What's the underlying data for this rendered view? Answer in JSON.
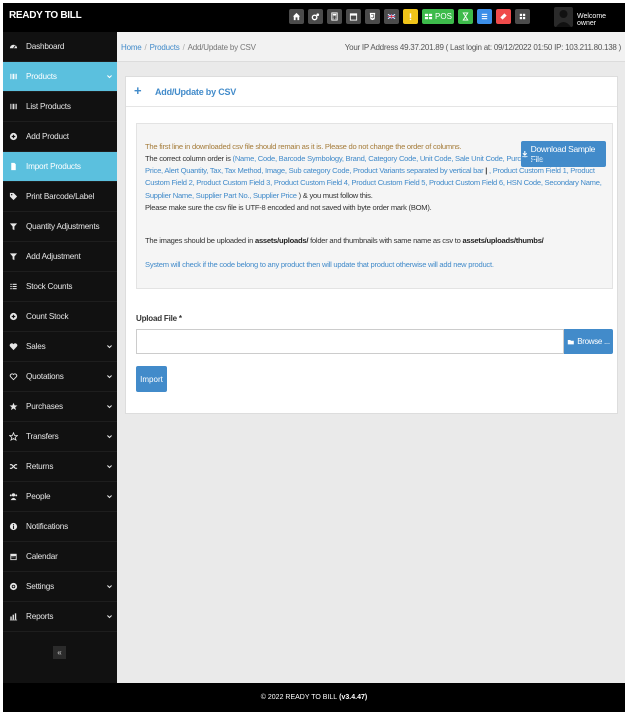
{
  "brand": "READY TO BILL",
  "topbar": {
    "pos_label": "POS",
    "welcome": "Welcome owner"
  },
  "sidebar": {
    "items": [
      {
        "label": "Dashboard",
        "icon": "dashboard-icon"
      },
      {
        "label": "Products",
        "icon": "barcode-icon"
      },
      {
        "label": "List Products",
        "icon": "barcode-icon"
      },
      {
        "label": "Add Product",
        "icon": "plus-circle-icon"
      },
      {
        "label": "Import Products",
        "icon": "file-icon"
      },
      {
        "label": "Print Barcode/Label",
        "icon": "tag-icon"
      },
      {
        "label": "Quantity Adjustments",
        "icon": "filter-icon"
      },
      {
        "label": "Add Adjustment",
        "icon": "filter-icon"
      },
      {
        "label": "Stock Counts",
        "icon": "list-icon"
      },
      {
        "label": "Count Stock",
        "icon": "plus-circle-icon"
      },
      {
        "label": "Sales",
        "icon": "heart-icon"
      },
      {
        "label": "Quotations",
        "icon": "heart-outline-icon"
      },
      {
        "label": "Purchases",
        "icon": "star-icon"
      },
      {
        "label": "Transfers",
        "icon": "star-outline-icon"
      },
      {
        "label": "Returns",
        "icon": "random-icon"
      },
      {
        "label": "People",
        "icon": "users-icon"
      },
      {
        "label": "Notifications",
        "icon": "info-icon"
      },
      {
        "label": "Calendar",
        "icon": "calendar-icon"
      },
      {
        "label": "Settings",
        "icon": "cog-icon"
      },
      {
        "label": "Reports",
        "icon": "bar-chart-icon"
      }
    ],
    "collapse": "«"
  },
  "breadcrumb": {
    "home": "Home",
    "products": "Products",
    "current": "Add/Update by CSV",
    "sep": "/"
  },
  "ip_info": "Your IP Address 49.37.201.89 ( Last login at: 09/12/2022 01:50 IP: 103.211.80.138 )",
  "panel": {
    "plus": "+",
    "title": "Add/Update by CSV",
    "download_label": "Download Sample File",
    "line1": "The first line in downloaded csv file should remain as it is. Please do not change the order of columns.",
    "line2_prefix": "The correct column order is ",
    "line2_columns": "(Name, Code, Barcode Symbology, Brand, Category Code, Unit Code, Sale Unit Code, Purchase Unit Code, Cost, Price, Alert Quantity, Tax, Tax Method, Image, Sub category Code, Product Variants separated by vertical bar",
    "line2_pipe": " | ",
    "line2_rest": ", Product Custom Field 1, Product Custom Field 2, Product Custom Field 3, Product Custom Field 4, Product Custom Field 5, Product Custom Field 6, HSN Code, Secondary Name, Supplier Name, Supplier Part No., Supplier Price",
    "line2_suffix": " ) & you must follow this.",
    "line3": "Please make sure the csv file is UTF-8 encoded and not saved with byte order mark (BOM).",
    "images_prefix": "The images should be uploaded in ",
    "images_folder": "assets/uploads/",
    "images_mid": " folder and thumbnails with same name as csv to ",
    "images_thumbs": "assets/uploads/thumbs/",
    "system_note": "System will check if the code belong to any product then will update that product otherwise will add new product.",
    "upload_label": "Upload File *",
    "file_value": "",
    "browse_label": "Browse ...",
    "import_label": "Import"
  },
  "footer": {
    "copyright": "© 2022 READY TO BILL",
    "version": "(v3.4.47)"
  },
  "colors": {
    "accent": "#428bca",
    "active": "#5bc0de",
    "sidebar_bg": "#111111",
    "pos_green": "#3dbb4b",
    "red": "#ef4b4b",
    "yellow": "#f0c419"
  }
}
